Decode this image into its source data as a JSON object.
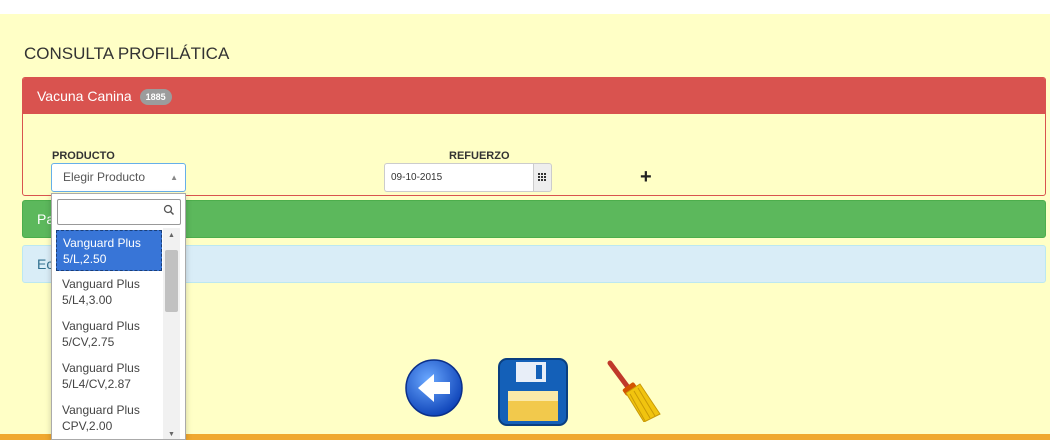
{
  "page": {
    "title": "CONSULTA PROFILÁTICA"
  },
  "panels": {
    "vacuna": {
      "title": "Vacuna Canina",
      "badge": "1885"
    },
    "green": {
      "title_partial": "Pa"
    },
    "blue": {
      "title_partial": "Ec"
    }
  },
  "form": {
    "producto_label": "PRODUCTO",
    "producto_placeholder": "Elegir Producto",
    "refuerzo_label": "REFUERZO",
    "refuerzo_value": "09-10-2015",
    "add_symbol": "+"
  },
  "dropdown": {
    "search_value": "",
    "options": [
      {
        "line1": "Vanguard Plus",
        "line2": "5/L,2.50",
        "selected": true
      },
      {
        "line1": "Vanguard Plus",
        "line2": "5/L4,3.00",
        "selected": false
      },
      {
        "line1": "Vanguard Plus",
        "line2": "5/CV,2.75",
        "selected": false
      },
      {
        "line1": "Vanguard Plus",
        "line2": "5/L4/CV,2.87",
        "selected": false
      },
      {
        "line1": "Vanguard Plus",
        "line2": "CPV,2.00",
        "selected": false
      }
    ]
  },
  "actions": {
    "back_icon": "back-arrow-icon",
    "save_icon": "floppy-disk-icon",
    "clear_icon": "broom-icon"
  },
  "colors": {
    "page_bg": "#ffffc6",
    "danger": "#d9534f",
    "success": "#5cb85c",
    "info": "#d9edf7",
    "selected": "#3875d7",
    "bottom_bar": "#f0a830"
  }
}
